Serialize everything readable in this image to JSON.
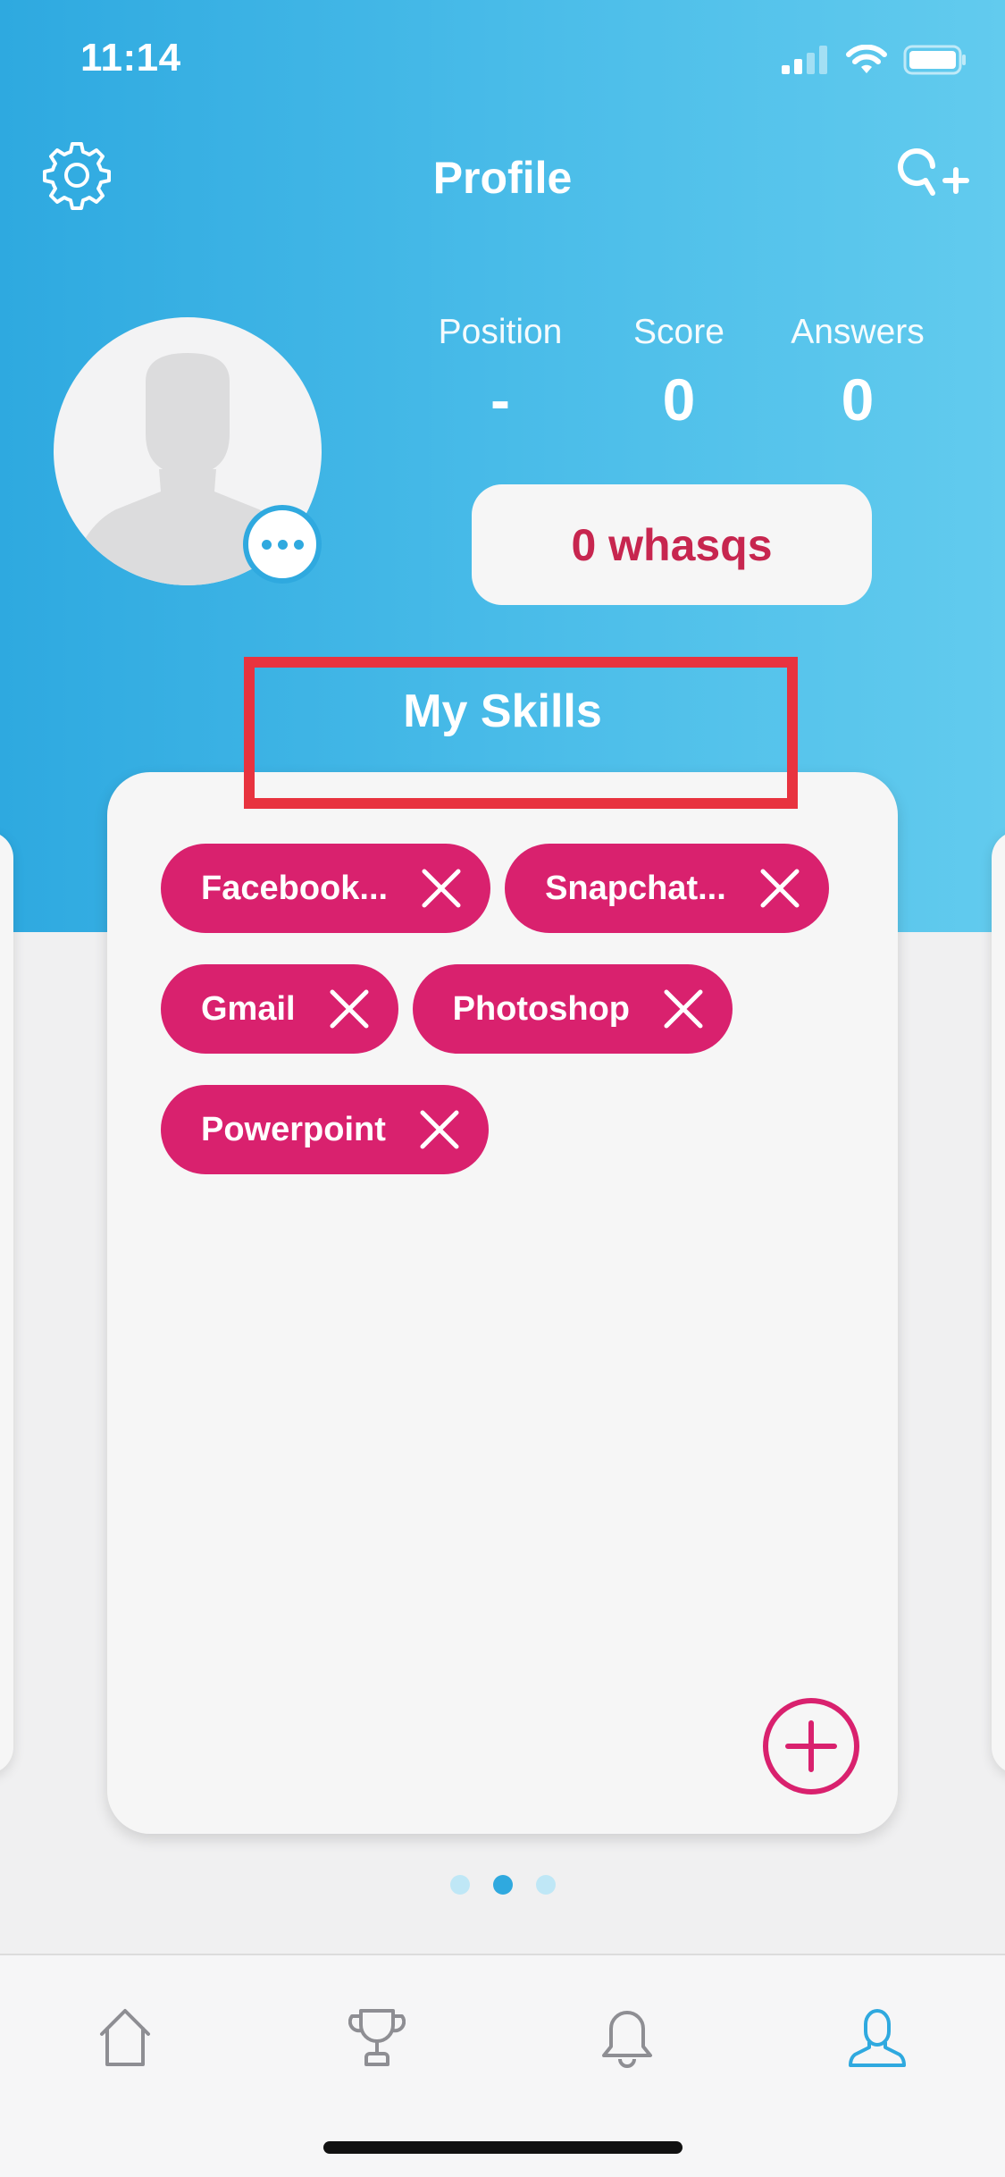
{
  "status_bar": {
    "time": "11:14"
  },
  "header": {
    "title": "Profile",
    "left_icon": "gear-icon",
    "right_icon": "search-add-icon"
  },
  "stats": [
    {
      "label": "Position",
      "value": "-"
    },
    {
      "label": "Score",
      "value": "0"
    },
    {
      "label": "Answers",
      "value": "0"
    }
  ],
  "whasqs_button": "0 whasqs",
  "skills": {
    "heading": "My Skills",
    "items": [
      {
        "label": "Facebook..."
      },
      {
        "label": "Snapchat..."
      },
      {
        "label": "Gmail"
      },
      {
        "label": "Photoshop"
      },
      {
        "label": "Powerpoint"
      }
    ],
    "add_icon": "plus-circle-icon"
  },
  "pager": {
    "count": 3,
    "active_index": 1
  },
  "tab_bar": {
    "tabs": [
      {
        "name": "home",
        "icon": "home-icon"
      },
      {
        "name": "leaderboard",
        "icon": "trophy-icon"
      },
      {
        "name": "notifications",
        "icon": "bell-icon"
      },
      {
        "name": "profile",
        "icon": "user-icon",
        "active": true
      }
    ]
  },
  "colors": {
    "header_blue": "#2ea9e0",
    "accent_pink": "#d9216e",
    "whasqs_red": "#c7264f",
    "highlight_red": "#e8333f",
    "active_tab": "#2fa9df"
  }
}
